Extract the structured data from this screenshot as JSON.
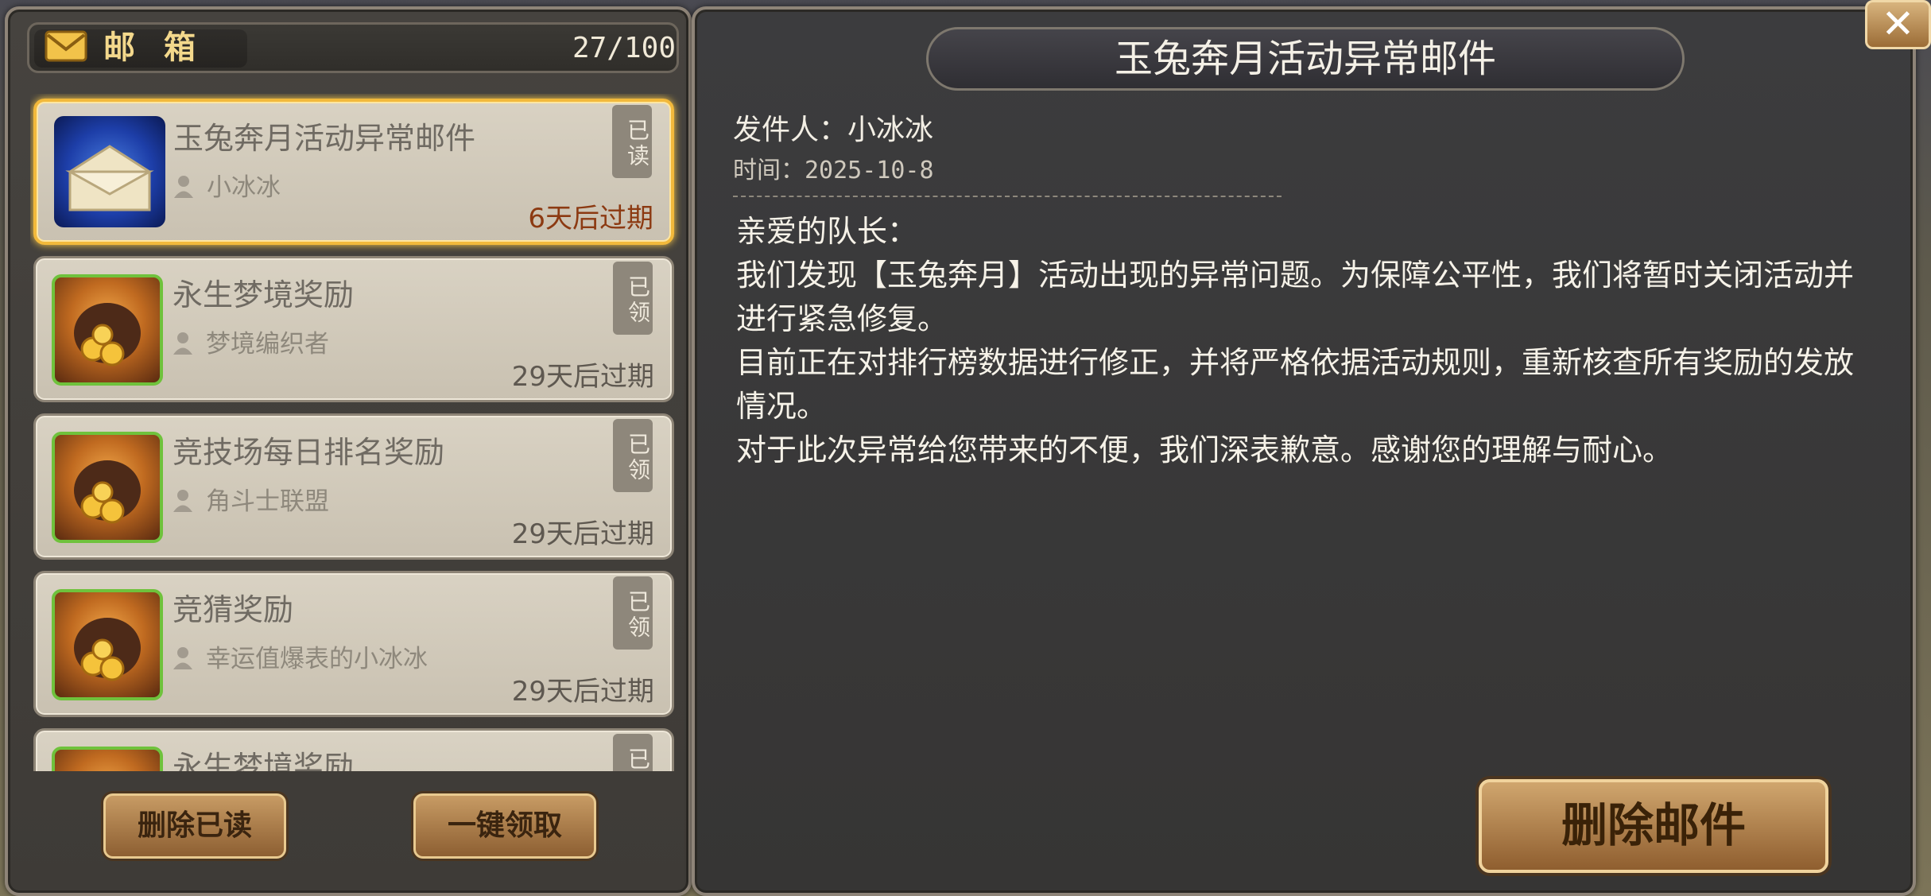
{
  "mailbox": {
    "title": "邮箱",
    "count": "27/100",
    "buttons": {
      "delete_read": "删除已读",
      "claim_all": "一键领取"
    },
    "items": [
      {
        "title": "玉兔奔月活动异常邮件",
        "sender": "小冰冰",
        "expiry": "6天后过期",
        "status": "已读",
        "icon": "envelope-icon",
        "selected": true
      },
      {
        "title": "永生梦境奖励",
        "sender": "梦境编织者",
        "expiry": "29天后过期",
        "status": "已领",
        "icon": "gold-bag-icon"
      },
      {
        "title": "竞技场每日排名奖励",
        "sender": "角斗士联盟",
        "expiry": "29天后过期",
        "status": "已领",
        "icon": "gold-bag-icon"
      },
      {
        "title": "竞猜奖励",
        "sender": "幸运值爆表的小冰冰",
        "expiry": "29天后过期",
        "status": "已领",
        "icon": "gold-bag-icon"
      },
      {
        "title": "永生梦境奖励",
        "sender": "",
        "expiry": "",
        "status": "已领",
        "icon": "gold-bag-icon"
      }
    ]
  },
  "mail_detail": {
    "title": "玉兔奔月活动异常邮件",
    "sender_line": "发件人：小冰冰",
    "time_line": "时间：2025-10-8",
    "body": [
      "亲爱的队长：",
      "我们发现【玉兔奔月】活动出现的异常问题。为保障公平性，我们将暂时关闭活动并进行紧急修复。",
      "目前正在对排行榜数据进行修正，并将严格依据活动规则，重新核查所有奖励的发放情况。",
      "对于此次异常给您带来的不便，我们深表歉意。感谢您的理解与耐心。"
    ],
    "delete_button": "删除邮件"
  },
  "close_icon": "close-icon"
}
